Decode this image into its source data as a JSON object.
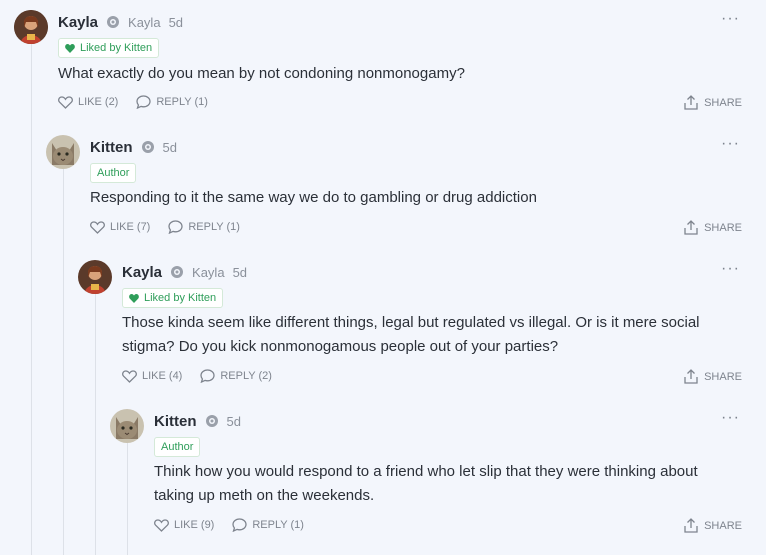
{
  "comments": [
    {
      "author": "Kayla",
      "handle": "Kayla",
      "time": "5d",
      "tag": "Liked by Kitten",
      "tag_type": "liked",
      "text": "What exactly do you mean by not condoning nonmonogamy?",
      "like": "LIKE (2)",
      "reply": "REPLY (1)",
      "share": "SHARE",
      "more": "···"
    },
    {
      "author": "Kitten",
      "handle": "",
      "time": "5d",
      "tag": "Author",
      "tag_type": "author",
      "text": "Responding to it the same way we do to gambling or drug addiction",
      "like": "LIKE (7)",
      "reply": "REPLY (1)",
      "share": "SHARE",
      "more": "···"
    },
    {
      "author": "Kayla",
      "handle": "Kayla",
      "time": "5d",
      "tag": "Liked by Kitten",
      "tag_type": "liked",
      "text": "Those kinda seem like different things, legal but regulated vs illegal. Or is it mere social stigma? Do you kick nonmonogamous people out of your parties?",
      "like": "LIKE (4)",
      "reply": "REPLY (2)",
      "share": "SHARE",
      "more": "···"
    },
    {
      "author": "Kitten",
      "handle": "",
      "time": "5d",
      "tag": "Author",
      "tag_type": "author",
      "text": "Think how you would respond to a friend who let slip that they were thinking about taking up meth on the weekends.",
      "like": "LIKE (9)",
      "reply": "REPLY (1)",
      "share": "SHARE",
      "more": "···"
    }
  ],
  "colors": {
    "accent_green": "#2f9e5a",
    "background": "#f3f6fc",
    "muted": "#7e848e"
  }
}
